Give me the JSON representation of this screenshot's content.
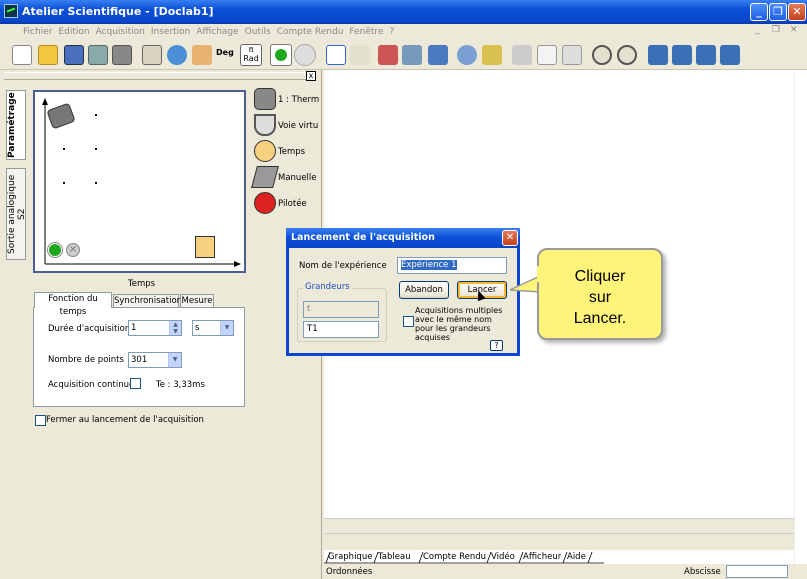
{
  "window": {
    "title": "Atelier Scientifique - [Doclab1]",
    "min_icon": "_",
    "max_icon": "❐",
    "close_icon": "✕"
  },
  "menubar": {
    "items": [
      "Fichier",
      "Edition",
      "Acquisition",
      "Insertion",
      "Affichage",
      "Outils",
      "Compte Rendu",
      "Fenêtre",
      "?"
    ],
    "min_icon": "_",
    "restore_icon": "❐",
    "close_icon": "✕"
  },
  "toolbar": {
    "deg_label": "Deg",
    "rad_label": "Rad",
    "pi_label": "π"
  },
  "left_panel": {
    "close_icon": "x",
    "vtab_parametrage": "Paramétrage",
    "vtab_sortie": "Sortie analogique S2",
    "sensors": [
      {
        "label": "1 : Therm",
        "icon": "thermometer-icon"
      },
      {
        "label": "Voie virtu",
        "icon": "virtual-channel-icon"
      },
      {
        "label": "Temps",
        "icon": "clock-icon"
      },
      {
        "label": "Manuelle",
        "icon": "hand-icon"
      },
      {
        "label": "Pilotée",
        "icon": "piloted-icon"
      }
    ],
    "preview_axis_label": "Temps",
    "tabs": [
      "Fonction du temps",
      "Synchronisation",
      "Mesure"
    ],
    "duree_label": "Durée d'acquisition",
    "duree_value": "1",
    "duree_unit": "s",
    "points_label": "Nombre de points",
    "points_value": "301",
    "continue_label": "Acquisition continue",
    "te_label": "Te : 3,33ms",
    "fermer_label": "Fermer au lancement de l'acquisition"
  },
  "bottom_tabs": [
    "Graphique",
    "Tableau",
    "Compte Rendu",
    "Vidéo",
    "Afficheur",
    "Aide"
  ],
  "status": {
    "ordonnees": "Ordonnées",
    "abscisse": "Abscisse"
  },
  "dialog": {
    "title": "Lancement de l'acquisition",
    "close_icon": "✕",
    "nom_label": "Nom de l'expérience",
    "nom_value": "Expérience 1",
    "grandeurs_label": "Grandeurs",
    "grandeur_1": "t",
    "grandeur_2": "T1",
    "abandon_label": "Abandon",
    "lancer_label": "Lancer",
    "multi_label": "Acquisitions multiples avec le même nom pour les grandeurs acquises",
    "help_label": "?"
  },
  "callout": {
    "text": "Cliquer sur Lancer."
  },
  "colors": {
    "titlebar": "#0a4fd6",
    "callout": "#fff37a",
    "dialog_border": "#0a46d2"
  }
}
